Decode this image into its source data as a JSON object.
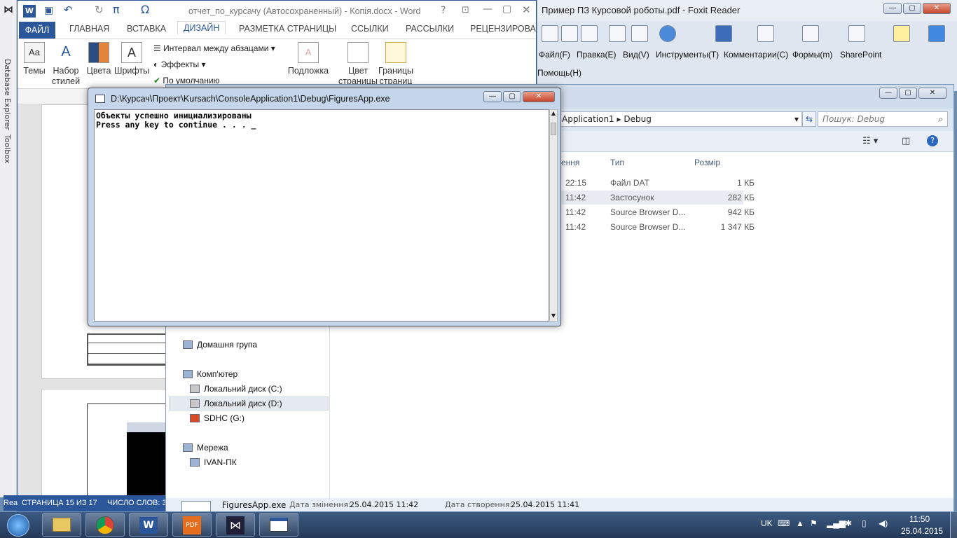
{
  "vs_strip": {
    "database_explorer": "Database Explorer",
    "toolbox": "Toolbox"
  },
  "word": {
    "title": "отчет_по_курсачу (Автосохраненный) - Копія.docx - Word",
    "tabs": [
      "ФАЙЛ",
      "ГЛАВНАЯ",
      "ВСТАВКА",
      "ДИЗАЙН",
      "РАЗМЕТКА СТРАНИЦЫ",
      "ССЫЛКИ",
      "РАССЫЛКИ",
      "РЕЦЕНЗИРОВА"
    ],
    "active_tab": "ДИЗАЙН",
    "ribbon": {
      "themes": "Темы",
      "style_set_1": "Набор",
      "style_set_2": "стилей",
      "colors": "Цвета",
      "fonts": "Шрифты",
      "paragraph_spacing": "Интервал между абзацами",
      "effects": "Эффекты",
      "default": "По умолчанию",
      "watermark": "Подложка",
      "page_color_1": "Цвет",
      "page_color_2": "страницы",
      "page_borders_1": "Границы",
      "page_borders_2": "страниц"
    },
    "status_page": "СТРАНИЦА 15 ИЗ 17",
    "status_words": "ЧИСЛО СЛОВ: 3",
    "ready": "Rea"
  },
  "foxit": {
    "title": "Пример ПЗ Курсовой роботы.pdf - Foxit Reader",
    "menu": [
      "Файл(F)",
      "Правка(E)",
      "Вид(V)",
      "Инструменты(T)",
      "Комментарии(C)",
      "Формы(m)",
      "SharePoint",
      "Помощь(H)"
    ]
  },
  "explorer": {
    "breadcrumb_1": "Application1",
    "breadcrumb_2": "Debug",
    "search_placeholder": "Пошук: Debug",
    "columns": {
      "modified": "ення",
      "type": "Тип",
      "size": "Розмір"
    },
    "files": [
      {
        "time": "22:15",
        "type": "Файл DAT",
        "size": "1 КБ"
      },
      {
        "time": "11:42",
        "type": "Застосунок",
        "size": "282 КБ"
      },
      {
        "time": "11:42",
        "type": "Source Browser D...",
        "size": "942 КБ"
      },
      {
        "time": "11:42",
        "type": "Source Browser D...",
        "size": "1 347 КБ"
      }
    ],
    "nav": {
      "homegroup": "Домашня група",
      "computer": "Комп'ютер",
      "disk_c": "Локальний диск (C:)",
      "disk_d": "Локальний диск (D:)",
      "sdhc": "SDHC (G:)",
      "network": "Мережа",
      "pc": "IVAN-ПК"
    },
    "details": {
      "file_name": "FiguresApp.exe",
      "modified_label": "Дата змінення:",
      "modified_value": "25.04.2015 11:42",
      "created_label": "Дата створення:",
      "created_value": "25.04.2015 11:41"
    }
  },
  "console": {
    "title": "D:\\Курсач\\Проект\\Kursach\\ConsoleApplication1\\Debug\\FiguresApp.exe",
    "line1": "Объекты успешно инициализированы",
    "line2": "Press any key to continue . . . _"
  },
  "taskbar": {
    "lang": "UK",
    "time": "11:50",
    "date": "25.04.2015"
  }
}
